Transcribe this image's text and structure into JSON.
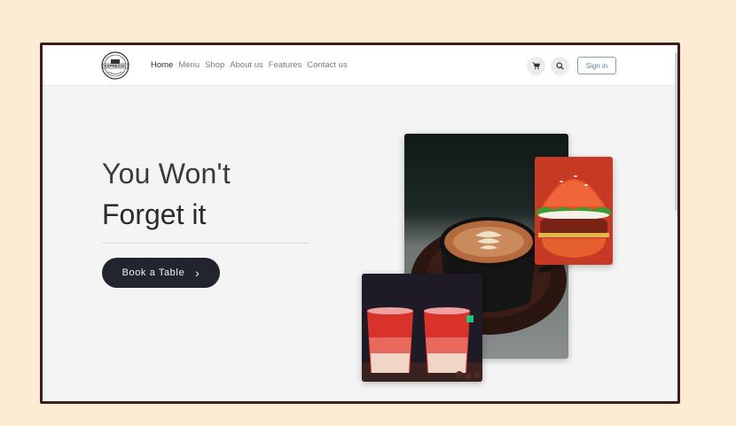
{
  "nav": {
    "logo_text": "ESPRESSO",
    "links": [
      "Home",
      "Menu",
      "Shop",
      "About us",
      "Features",
      "Contact us"
    ],
    "signin_label": "Sign in"
  },
  "icons": {
    "cart": "cart-icon",
    "search": "search-icon",
    "chevron": "chevron-right-icon"
  },
  "hero": {
    "title_line1": "You Won't",
    "title_line2": "Forget it",
    "button_label": "Book a Table",
    "button_chevron": "›"
  },
  "colors": {
    "page_background": "#fdebd3",
    "frame_border": "#3c1f1b",
    "button_background": "#22252e",
    "signin_border": "#7fa1b0"
  }
}
